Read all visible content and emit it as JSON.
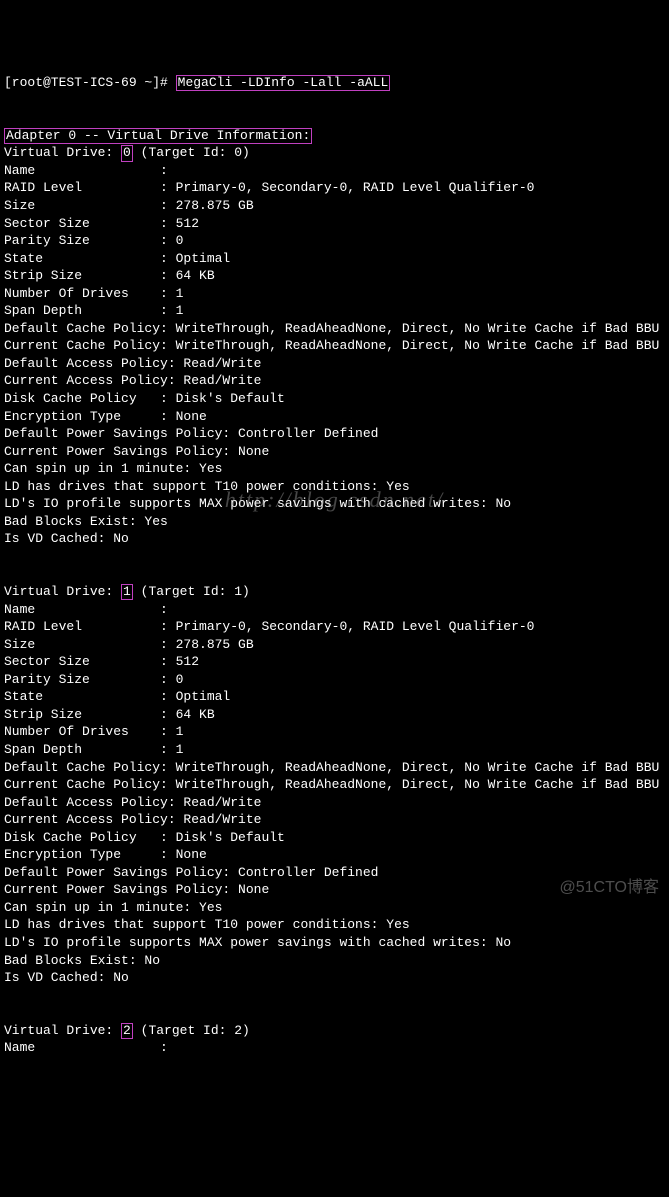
{
  "prompt": "[root@TEST-ICS-69 ~]# ",
  "command": "MegaCli -LDInfo -Lall -aALL",
  "adapter_header": "Adapter 0 -- Virtual Drive Information:",
  "vd0_prefix": "Virtual Drive: ",
  "vd0_num": "0",
  "vd0_suffix": " (Target Id: 0)",
  "vd0_lines": [
    "Name                :",
    "RAID Level          : Primary-0, Secondary-0, RAID Level Qualifier-0",
    "Size                : 278.875 GB",
    "Sector Size         : 512",
    "Parity Size         : 0",
    "State               : Optimal",
    "Strip Size          : 64 KB",
    "Number Of Drives    : 1",
    "Span Depth          : 1",
    "Default Cache Policy: WriteThrough, ReadAheadNone, Direct, No Write Cache if Bad BBU",
    "Current Cache Policy: WriteThrough, ReadAheadNone, Direct, No Write Cache if Bad BBU",
    "Default Access Policy: Read/Write",
    "Current Access Policy: Read/Write",
    "Disk Cache Policy   : Disk's Default",
    "Encryption Type     : None",
    "Default Power Savings Policy: Controller Defined",
    "Current Power Savings Policy: None",
    "Can spin up in 1 minute: Yes",
    "LD has drives that support T10 power conditions: Yes",
    "LD's IO profile supports MAX power savings with cached writes: No",
    "Bad Blocks Exist: Yes",
    "Is VD Cached: No"
  ],
  "vd1_prefix": "Virtual Drive: ",
  "vd1_num": "1",
  "vd1_suffix": " (Target Id: 1)",
  "vd1_lines": [
    "Name                :",
    "RAID Level          : Primary-0, Secondary-0, RAID Level Qualifier-0",
    "Size                : 278.875 GB",
    "Sector Size         : 512",
    "Parity Size         : 0",
    "State               : Optimal",
    "Strip Size          : 64 KB",
    "Number Of Drives    : 1",
    "Span Depth          : 1",
    "Default Cache Policy: WriteThrough, ReadAheadNone, Direct, No Write Cache if Bad BBU",
    "Current Cache Policy: WriteThrough, ReadAheadNone, Direct, No Write Cache if Bad BBU",
    "Default Access Policy: Read/Write",
    "Current Access Policy: Read/Write",
    "Disk Cache Policy   : Disk's Default",
    "Encryption Type     : None",
    "Default Power Savings Policy: Controller Defined",
    "Current Power Savings Policy: None",
    "Can spin up in 1 minute: Yes",
    "LD has drives that support T10 power conditions: Yes",
    "LD's IO profile supports MAX power savings with cached writes: No",
    "Bad Blocks Exist: No",
    "Is VD Cached: No"
  ],
  "vd2_prefix": "Virtual Drive: ",
  "vd2_num": "2",
  "vd2_suffix": " (Target Id: 2)",
  "vd2_lines": [
    "Name                :"
  ],
  "watermark1": "http://blog.csdn.net/",
  "watermark2": "@51CTO博客"
}
